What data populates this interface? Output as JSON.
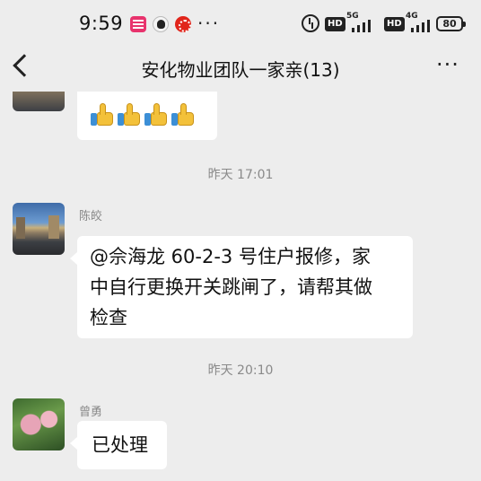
{
  "status_bar": {
    "time": "9:59",
    "network_1": "5G",
    "network_2": "4G",
    "hd_label": "HD",
    "battery": "80",
    "icons": [
      "app-notification-icon",
      "qq-icon",
      "app-icon",
      "more-icon",
      "alarm-icon",
      "signal-icon",
      "battery-icon"
    ]
  },
  "header": {
    "title": "安化物业团队一家亲(13)",
    "back_icon": "chevron-left-icon",
    "menu_icon": "more-horizontal-icon"
  },
  "messages": [
    {
      "type": "emoji",
      "content": "thumbs-up x4",
      "count": 4
    },
    {
      "type": "timestamp",
      "text": "昨天 17:01"
    },
    {
      "type": "text",
      "sender": "陈皎",
      "lines": [
        "@佘海龙  60-2-3 号住户报修，家",
        "中自行更换开关跳闸了，请帮其做",
        "检查"
      ]
    },
    {
      "type": "timestamp",
      "text": "昨天 20:10"
    },
    {
      "type": "text",
      "sender": "曾勇",
      "lines": [
        "已处理"
      ]
    }
  ],
  "colors": {
    "background": "#ededed",
    "bubble": "#ffffff",
    "timestamp": "#8a8a8a"
  }
}
